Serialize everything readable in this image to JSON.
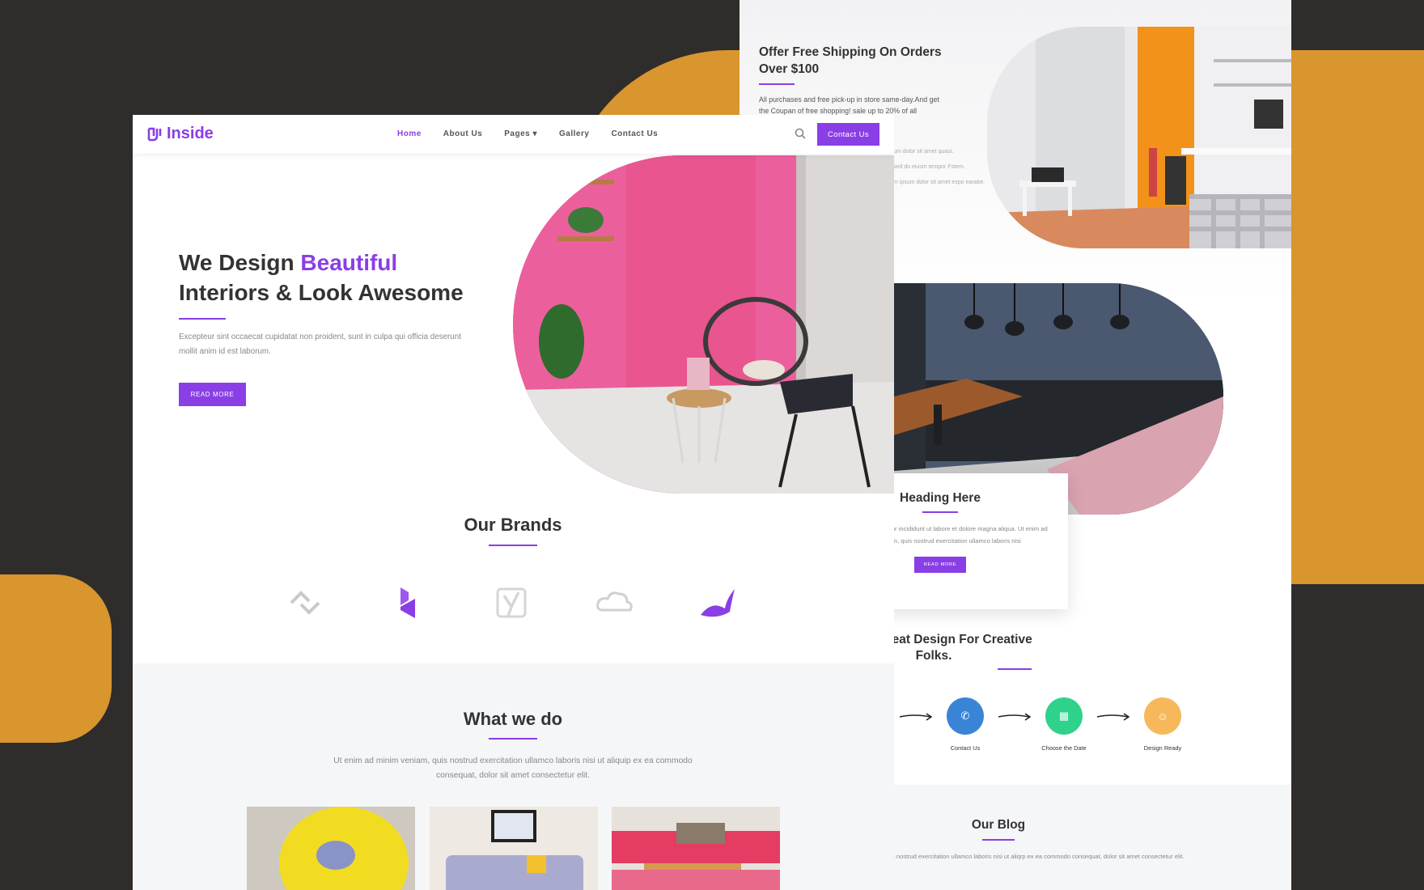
{
  "colors": {
    "accent": "#8a3ee6",
    "decor": "#d9952e",
    "background": "#2e2d2b"
  },
  "front": {
    "logo": {
      "text": "Inside",
      "icon": "logo-icon"
    },
    "nav": {
      "items": [
        {
          "label": "Home",
          "active": true
        },
        {
          "label": "About Us"
        },
        {
          "label": "Pages ▾"
        },
        {
          "label": "Gallery"
        },
        {
          "label": "Contact Us"
        }
      ],
      "search_icon": "search-icon",
      "cta_label": "Contact Us"
    },
    "hero": {
      "title_part1": "We Design ",
      "title_accent": "Beautiful",
      "title_part2": "Interiors & Look Awesome",
      "text": "Excepteur sint occaecat cupidatat non proident, sunt in culpa qui officia deserunt mollit anim id est laborum.",
      "button": "READ MORE"
    },
    "brands": {
      "title": "Our Brands",
      "icons": [
        "brand-chain-icon",
        "brand-hex-icon",
        "brand-y-icon",
        "brand-cloud-icon",
        "brand-bird-icon"
      ]
    },
    "what_we_do": {
      "title": "What we do",
      "text": "Ut enim ad minim veniam, quis nostrud exercitation ullamco laboris nisi ut aliquip ex ea commodo consequat, dolor sit amet consectetur elit."
    }
  },
  "back": {
    "shipping": {
      "title": "Offer Free Shipping On Orders Over $100",
      "text": "All purchases and free pick-up in store same-day.And get the Coupan of free shopping! sale up to 20% of all",
      "list": [
        "um dolor sit amet quasi.",
        "sed do eiusm tempor Fstem.",
        "m ipsum dolor sit amet expo earabe."
      ]
    },
    "card": {
      "title": "Heading Here",
      "text": "sed do eiusmod tempor incididunt ut labore et dolore magna aliqua. Ut enim ad minim veniam, quis nostrud exercitation ullamco laboris nisi",
      "button": "READ MORE"
    },
    "creative": {
      "title": "We Do Great Design For Creative Folks.",
      "steps": [
        {
          "label": "Contact Us",
          "icon": "phone-icon",
          "color": "#3a84d6"
        },
        {
          "label": "Choose the Date",
          "icon": "calendar-icon",
          "color": "#2fd28a"
        },
        {
          "label": "Design Ready",
          "icon": "smile-icon",
          "color": "#f7b85c"
        }
      ]
    },
    "blog": {
      "title": "Our Blog",
      "text": "ut enim ad minim veniam, quis nostrud exercitation ullamco laboris nisi ut aliqrp ex ea commodo consequat, dolor sit amet consectetur elit."
    }
  }
}
